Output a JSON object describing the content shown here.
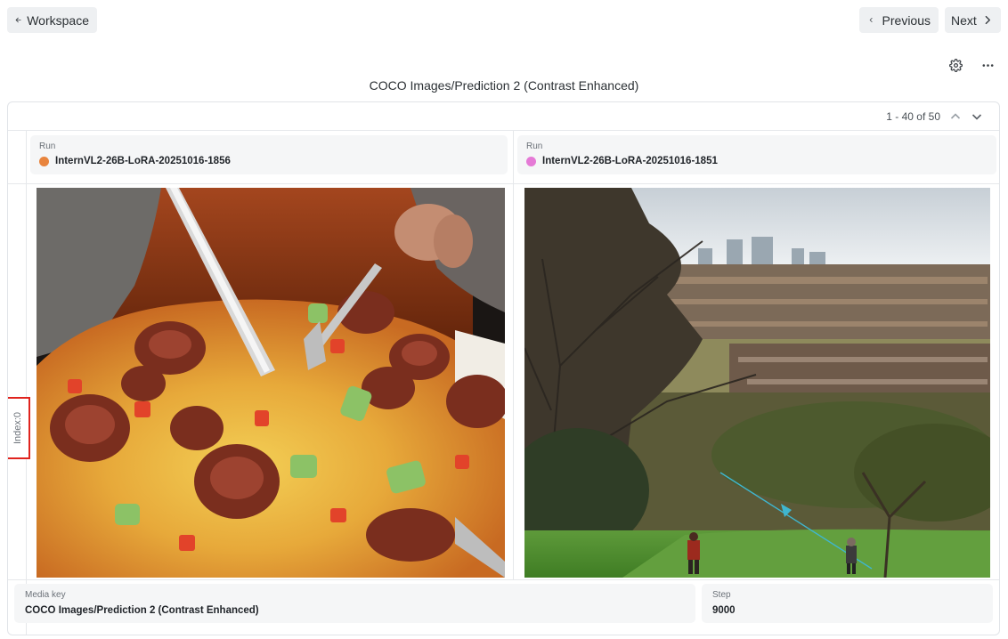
{
  "header": {
    "back_label": "Workspace",
    "prev_label": "Previous",
    "next_label": "Next"
  },
  "panel": {
    "title": "COCO Images/Prediction 2 (Contrast Enhanced)",
    "pagination": "1 - 40 of 50",
    "index_label": "Index:0"
  },
  "runs": [
    {
      "label": "Run",
      "name": "InternVL2-26B-LoRA-20251016-1856",
      "color": "#e8843d"
    },
    {
      "label": "Run",
      "name": "InternVL2-26B-LoRA-20251016-1851",
      "color": "#e57ad6"
    }
  ],
  "footer": {
    "media_key_label": "Media key",
    "media_key_value": "COCO Images/Prediction 2 (Contrast Enhanced)",
    "step_label": "Step",
    "step_value": "9000"
  }
}
